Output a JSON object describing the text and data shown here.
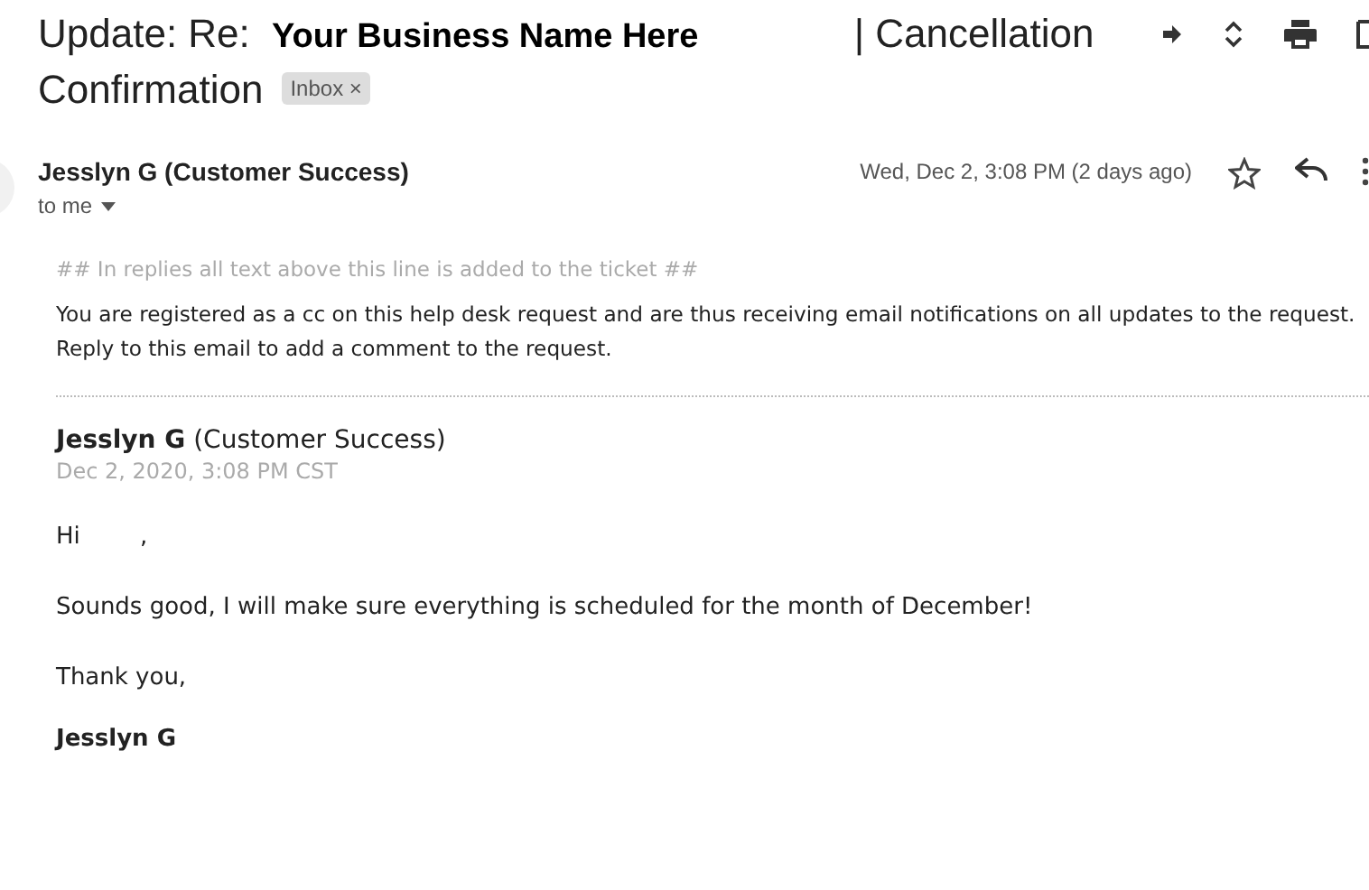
{
  "subject": {
    "text": "Update: Re: **Your Business Name Here** | Cancellation Confirmation",
    "label": "Inbox",
    "label_close": "×"
  },
  "message": {
    "sender": "Jesslyn G (Customer Success)",
    "recipient": "to me",
    "date": "Wed, Dec 2, 3:08 PM (2 days ago)",
    "starred": false
  },
  "body": {
    "notice": "## In replies all text above this line is added to the ticket ##",
    "intro": "You are registered as a cc on this help desk request and are thus receiving email notifications on all updates to the request.",
    "intro_2": "Reply to this email to add a comment to the request.",
    "author": "Jesslyn G",
    "author_role": "(Customer Success)",
    "posted": "Dec 2, 2020, 3:08 PM CST",
    "paragraphs": [
      {
        "text": "Hi        ,",
        "kind": "plain"
      },
      {
        "text": "Sounds good, I will make sure everything is scheduled for the month of December!",
        "kind": "plain"
      },
      {
        "text": "Thank you,",
        "kind": "plain"
      },
      {
        "text": "Jesslyn G",
        "kind": "signature"
      }
    ]
  }
}
